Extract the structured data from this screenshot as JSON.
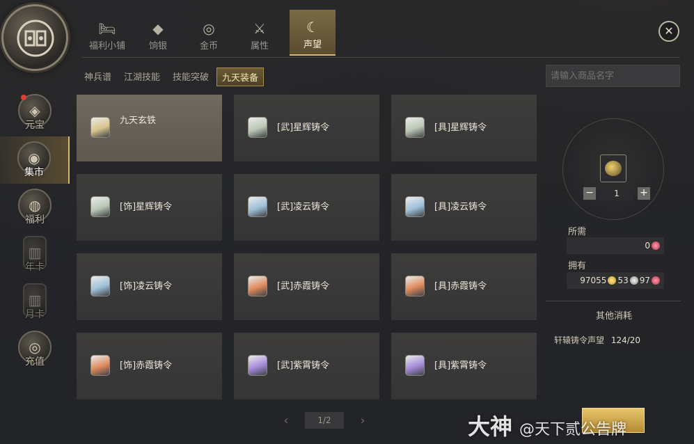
{
  "top_tabs": [
    {
      "label": "福利小铺",
      "icon": "bed-icon"
    },
    {
      "label": "饷银",
      "icon": "ingot-icon"
    },
    {
      "label": "金币",
      "icon": "coin-icon"
    },
    {
      "label": "属性",
      "icon": "sword-icon"
    },
    {
      "label": "声望",
      "icon": "horn-icon",
      "active": true
    }
  ],
  "sidebar": [
    {
      "label": "元宝",
      "badge": true
    },
    {
      "label": "集市",
      "active": true
    },
    {
      "label": "福利"
    },
    {
      "label": "年卡",
      "dim": true
    },
    {
      "label": "月卡",
      "dim": true
    },
    {
      "label": "充值"
    }
  ],
  "sub_tabs": [
    "神兵谱",
    "江湖技能",
    "技能突破",
    "九天装备"
  ],
  "active_sub_tab": 3,
  "items": [
    {
      "name": "九天玄铁",
      "tint": "#d9c38a",
      "selected": true
    },
    {
      "name": "[武]星辉铸令",
      "tint": "#b9c6b4"
    },
    {
      "name": "[具]星辉铸令",
      "tint": "#b9c6b4"
    },
    {
      "name": "[饰]星辉铸令",
      "tint": "#b9c6b4"
    },
    {
      "name": "[武]凌云铸令",
      "tint": "#9fc0d8"
    },
    {
      "name": "[具]凌云铸令",
      "tint": "#9fc0d8"
    },
    {
      "name": "[饰]凌云铸令",
      "tint": "#9fc0d8"
    },
    {
      "name": "[武]赤霞铸令",
      "tint": "#e08a5c"
    },
    {
      "name": "[具]赤霞铸令",
      "tint": "#e08a5c"
    },
    {
      "name": "[饰]赤霞铸令",
      "tint": "#e08a5c"
    },
    {
      "name": "[武]紫霄铸令",
      "tint": "#a58ad8"
    },
    {
      "name": "[具]紫霄铸令",
      "tint": "#a58ad8"
    }
  ],
  "pager": {
    "text": "1/2",
    "prev": "‹",
    "next": "›"
  },
  "search": {
    "placeholder": "请输入商品名字"
  },
  "detail": {
    "quantity": "1",
    "minus": "−",
    "plus": "+",
    "required_label": "所需",
    "required_value": "0",
    "owned_label": "拥有",
    "owned_gold": "97055",
    "owned_silver": "53",
    "owned_rep": "97",
    "other_cost_label": "其他消耗",
    "requirement_label": "轩辕铸令声望",
    "requirement_value": "124/20"
  },
  "close_label": "✕",
  "watermark": {
    "main": "大神",
    "sub": "@天下贰公告牌"
  }
}
